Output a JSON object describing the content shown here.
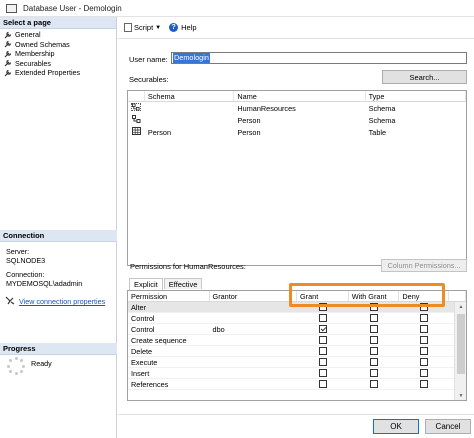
{
  "window": {
    "title": "Database User - Demologin"
  },
  "left_panel": {
    "select_page_header": "Select a page",
    "pages": [
      "General",
      "Owned Schemas",
      "Membership",
      "Securables",
      "Extended Properties"
    ],
    "connection_header": "Connection",
    "server_label": "Server:",
    "server_value": "SQLNODE3",
    "connection_label": "Connection:",
    "connection_value": "MYDEMOSQL\\adadmin",
    "view_connection_link": "View connection properties",
    "progress_header": "Progress",
    "progress_status": "Ready"
  },
  "toolbar": {
    "script_label": "Script",
    "help_label": "Help"
  },
  "form": {
    "user_name_label": "User name:",
    "user_name_value": "Demologin",
    "securables_label": "Securables:",
    "search_button": "Search...",
    "securables_columns": [
      "Schema",
      "Name",
      "Type"
    ],
    "securables_rows": [
      {
        "icon": "schema-icon",
        "schema": "",
        "name": "HumanResources",
        "type": "Schema"
      },
      {
        "icon": "schema-icon",
        "schema": "",
        "name": "Person",
        "type": "Schema"
      },
      {
        "icon": "table-icon",
        "schema": "Person",
        "name": "Person",
        "type": "Table"
      }
    ],
    "permissions_label": "Permissions for HumanResources:",
    "column_permissions_button": "Column Permissions...",
    "tabs": [
      "Explicit",
      "Effective"
    ],
    "permissions_columns": [
      "Permission",
      "Grantor",
      "Grant",
      "With Grant",
      "Deny"
    ],
    "permissions_rows": [
      {
        "permission": "Alter",
        "grantor": "",
        "grant": false,
        "with_grant": false,
        "deny": false
      },
      {
        "permission": "Control",
        "grantor": "",
        "grant": false,
        "with_grant": false,
        "deny": false
      },
      {
        "permission": "Control",
        "grantor": "dbo",
        "grant": true,
        "with_grant": false,
        "deny": false
      },
      {
        "permission": "Create sequence",
        "grantor": "",
        "grant": false,
        "with_grant": false,
        "deny": false
      },
      {
        "permission": "Delete",
        "grantor": "",
        "grant": false,
        "with_grant": false,
        "deny": false
      },
      {
        "permission": "Execute",
        "grantor": "",
        "grant": false,
        "with_grant": false,
        "deny": false
      },
      {
        "permission": "Insert",
        "grantor": "",
        "grant": false,
        "with_grant": false,
        "deny": false
      },
      {
        "permission": "References",
        "grantor": "",
        "grant": false,
        "with_grant": false,
        "deny": false
      }
    ]
  },
  "footer": {
    "ok_button": "OK",
    "cancel_button": "Cancel"
  },
  "colors": {
    "highlight": "#f08a25",
    "selection": "#3875d7",
    "link": "#1a55b8",
    "header_bg": "#dde6f3"
  }
}
